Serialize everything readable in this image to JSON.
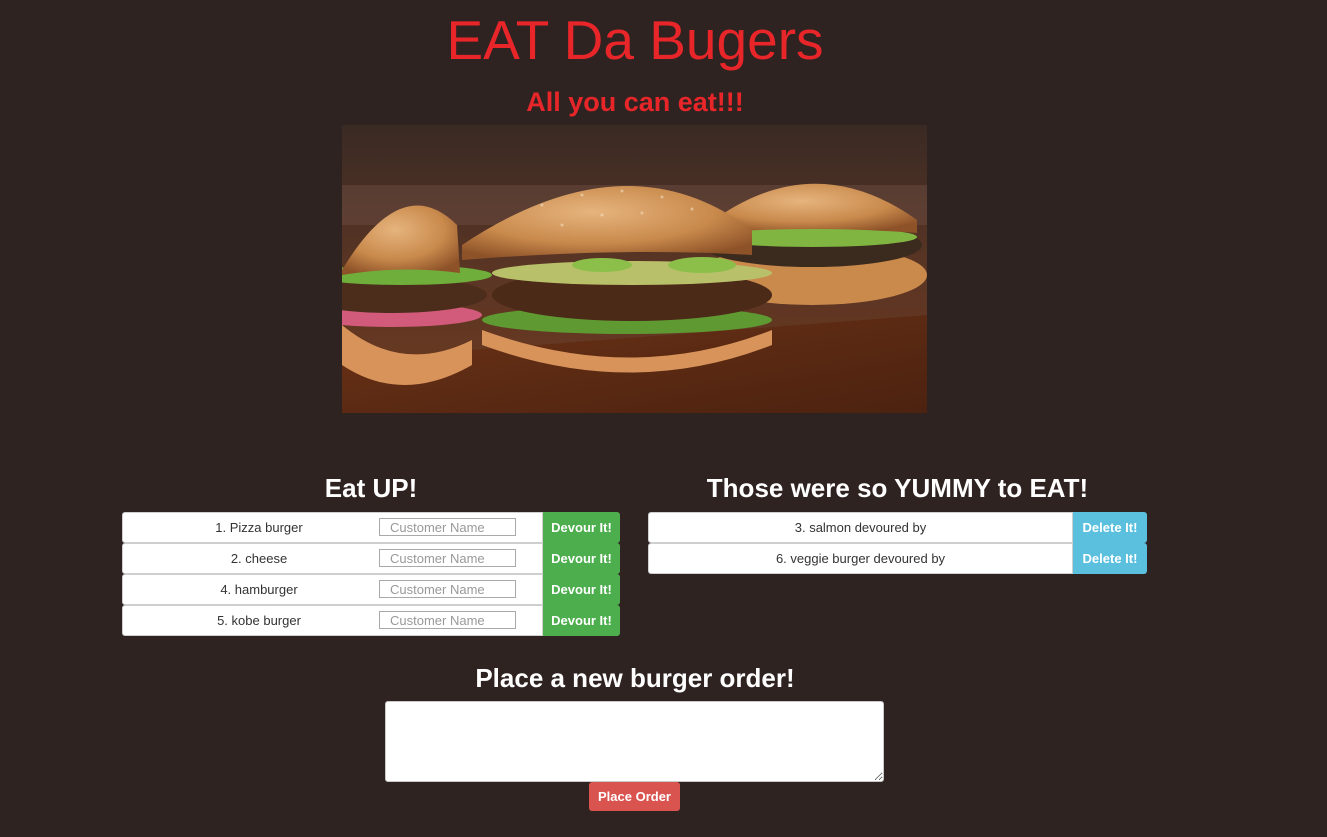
{
  "header": {
    "title": "EAT Da Bugers",
    "subtitle": "All you can eat!!!"
  },
  "hero_image": {
    "icon": "burger-photo"
  },
  "eat_up": {
    "heading": "Eat UP!",
    "input_placeholder": "Customer Name",
    "button_label": "Devour It!",
    "items": [
      {
        "label": "1. Pizza burger"
      },
      {
        "label": "2. cheese"
      },
      {
        "label": "4. hamburger"
      },
      {
        "label": "5. kobe burger"
      }
    ]
  },
  "devoured": {
    "heading": "Those were so YUMMY to EAT!",
    "button_label": "Delete It!",
    "items": [
      {
        "label": "3. salmon devoured by"
      },
      {
        "label": "6. veggie burger devoured by"
      }
    ]
  },
  "order_form": {
    "heading": "Place a new burger order!",
    "textarea_value": "",
    "button_label": "Place Order"
  },
  "colors": {
    "background": "#2f2321",
    "title_red": "#e8262a",
    "devour_green": "#4cae4c",
    "delete_blue": "#5bc0de",
    "order_red": "#d9534f"
  }
}
